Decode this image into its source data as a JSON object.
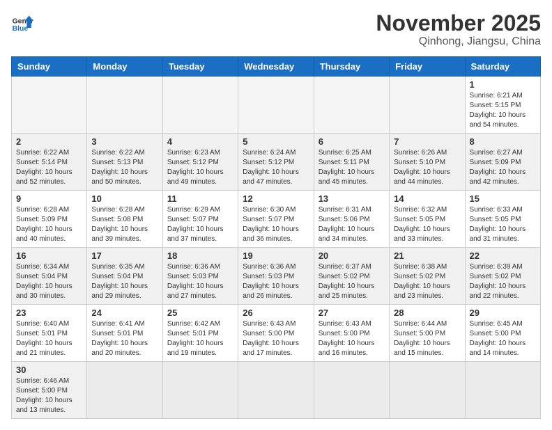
{
  "header": {
    "logo_general": "General",
    "logo_blue": "Blue",
    "month_title": "November 2025",
    "location": "Qinhong, Jiangsu, China"
  },
  "days_of_week": [
    "Sunday",
    "Monday",
    "Tuesday",
    "Wednesday",
    "Thursday",
    "Friday",
    "Saturday"
  ],
  "weeks": [
    {
      "shaded": false,
      "days": [
        {
          "num": "",
          "info": ""
        },
        {
          "num": "",
          "info": ""
        },
        {
          "num": "",
          "info": ""
        },
        {
          "num": "",
          "info": ""
        },
        {
          "num": "",
          "info": ""
        },
        {
          "num": "",
          "info": ""
        },
        {
          "num": "1",
          "info": "Sunrise: 6:21 AM\nSunset: 5:15 PM\nDaylight: 10 hours\nand 54 minutes."
        }
      ]
    },
    {
      "shaded": true,
      "days": [
        {
          "num": "2",
          "info": "Sunrise: 6:22 AM\nSunset: 5:14 PM\nDaylight: 10 hours\nand 52 minutes."
        },
        {
          "num": "3",
          "info": "Sunrise: 6:22 AM\nSunset: 5:13 PM\nDaylight: 10 hours\nand 50 minutes."
        },
        {
          "num": "4",
          "info": "Sunrise: 6:23 AM\nSunset: 5:12 PM\nDaylight: 10 hours\nand 49 minutes."
        },
        {
          "num": "5",
          "info": "Sunrise: 6:24 AM\nSunset: 5:12 PM\nDaylight: 10 hours\nand 47 minutes."
        },
        {
          "num": "6",
          "info": "Sunrise: 6:25 AM\nSunset: 5:11 PM\nDaylight: 10 hours\nand 45 minutes."
        },
        {
          "num": "7",
          "info": "Sunrise: 6:26 AM\nSunset: 5:10 PM\nDaylight: 10 hours\nand 44 minutes."
        },
        {
          "num": "8",
          "info": "Sunrise: 6:27 AM\nSunset: 5:09 PM\nDaylight: 10 hours\nand 42 minutes."
        }
      ]
    },
    {
      "shaded": false,
      "days": [
        {
          "num": "9",
          "info": "Sunrise: 6:28 AM\nSunset: 5:09 PM\nDaylight: 10 hours\nand 40 minutes."
        },
        {
          "num": "10",
          "info": "Sunrise: 6:28 AM\nSunset: 5:08 PM\nDaylight: 10 hours\nand 39 minutes."
        },
        {
          "num": "11",
          "info": "Sunrise: 6:29 AM\nSunset: 5:07 PM\nDaylight: 10 hours\nand 37 minutes."
        },
        {
          "num": "12",
          "info": "Sunrise: 6:30 AM\nSunset: 5:07 PM\nDaylight: 10 hours\nand 36 minutes."
        },
        {
          "num": "13",
          "info": "Sunrise: 6:31 AM\nSunset: 5:06 PM\nDaylight: 10 hours\nand 34 minutes."
        },
        {
          "num": "14",
          "info": "Sunrise: 6:32 AM\nSunset: 5:05 PM\nDaylight: 10 hours\nand 33 minutes."
        },
        {
          "num": "15",
          "info": "Sunrise: 6:33 AM\nSunset: 5:05 PM\nDaylight: 10 hours\nand 31 minutes."
        }
      ]
    },
    {
      "shaded": true,
      "days": [
        {
          "num": "16",
          "info": "Sunrise: 6:34 AM\nSunset: 5:04 PM\nDaylight: 10 hours\nand 30 minutes."
        },
        {
          "num": "17",
          "info": "Sunrise: 6:35 AM\nSunset: 5:04 PM\nDaylight: 10 hours\nand 29 minutes."
        },
        {
          "num": "18",
          "info": "Sunrise: 6:36 AM\nSunset: 5:03 PM\nDaylight: 10 hours\nand 27 minutes."
        },
        {
          "num": "19",
          "info": "Sunrise: 6:36 AM\nSunset: 5:03 PM\nDaylight: 10 hours\nand 26 minutes."
        },
        {
          "num": "20",
          "info": "Sunrise: 6:37 AM\nSunset: 5:02 PM\nDaylight: 10 hours\nand 25 minutes."
        },
        {
          "num": "21",
          "info": "Sunrise: 6:38 AM\nSunset: 5:02 PM\nDaylight: 10 hours\nand 23 minutes."
        },
        {
          "num": "22",
          "info": "Sunrise: 6:39 AM\nSunset: 5:02 PM\nDaylight: 10 hours\nand 22 minutes."
        }
      ]
    },
    {
      "shaded": false,
      "days": [
        {
          "num": "23",
          "info": "Sunrise: 6:40 AM\nSunset: 5:01 PM\nDaylight: 10 hours\nand 21 minutes."
        },
        {
          "num": "24",
          "info": "Sunrise: 6:41 AM\nSunset: 5:01 PM\nDaylight: 10 hours\nand 20 minutes."
        },
        {
          "num": "25",
          "info": "Sunrise: 6:42 AM\nSunset: 5:01 PM\nDaylight: 10 hours\nand 19 minutes."
        },
        {
          "num": "26",
          "info": "Sunrise: 6:43 AM\nSunset: 5:00 PM\nDaylight: 10 hours\nand 17 minutes."
        },
        {
          "num": "27",
          "info": "Sunrise: 6:43 AM\nSunset: 5:00 PM\nDaylight: 10 hours\nand 16 minutes."
        },
        {
          "num": "28",
          "info": "Sunrise: 6:44 AM\nSunset: 5:00 PM\nDaylight: 10 hours\nand 15 minutes."
        },
        {
          "num": "29",
          "info": "Sunrise: 6:45 AM\nSunset: 5:00 PM\nDaylight: 10 hours\nand 14 minutes."
        }
      ]
    },
    {
      "shaded": true,
      "days": [
        {
          "num": "30",
          "info": "Sunrise: 6:46 AM\nSunset: 5:00 PM\nDaylight: 10 hours\nand 13 minutes."
        },
        {
          "num": "",
          "info": ""
        },
        {
          "num": "",
          "info": ""
        },
        {
          "num": "",
          "info": ""
        },
        {
          "num": "",
          "info": ""
        },
        {
          "num": "",
          "info": ""
        },
        {
          "num": "",
          "info": ""
        }
      ]
    }
  ]
}
